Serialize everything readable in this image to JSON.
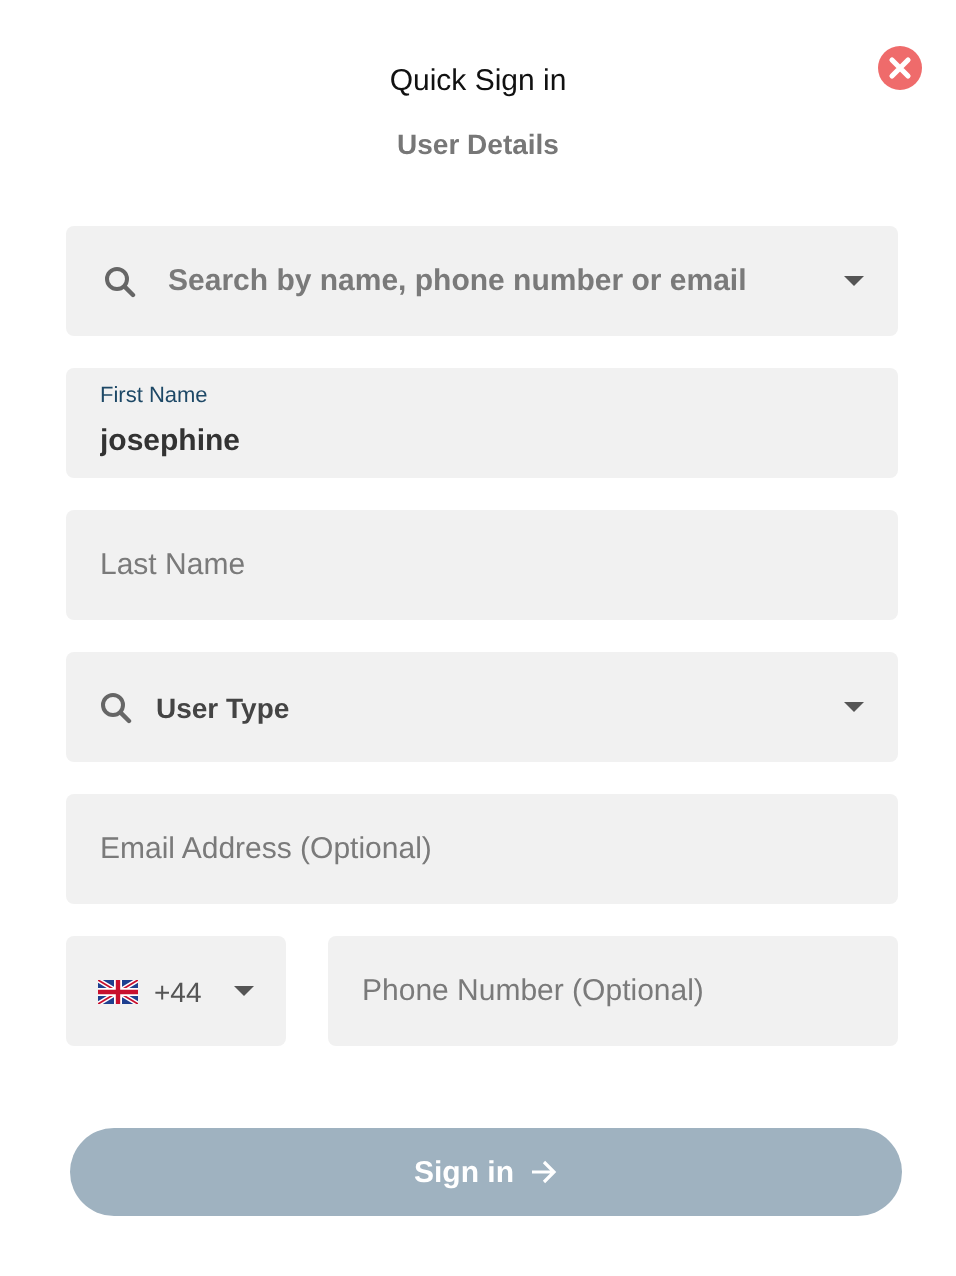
{
  "dialog": {
    "title": "Quick Sign in",
    "subtitle": "User Details"
  },
  "fields": [
    {
      "kind": "search",
      "placeholder": "Search by name, phone number or email"
    },
    {
      "kind": "filled",
      "label": "First Name",
      "value": "josephine"
    },
    {
      "kind": "empty",
      "placeholder": "Last Name"
    },
    {
      "kind": "select",
      "label": "User Type"
    },
    {
      "kind": "empty",
      "placeholder": "Email Address (Optional)"
    }
  ],
  "phone": {
    "country_code": "+44",
    "placeholder": "Phone Number (Optional)"
  },
  "submit": {
    "label": "Sign in",
    "disabled": true
  }
}
